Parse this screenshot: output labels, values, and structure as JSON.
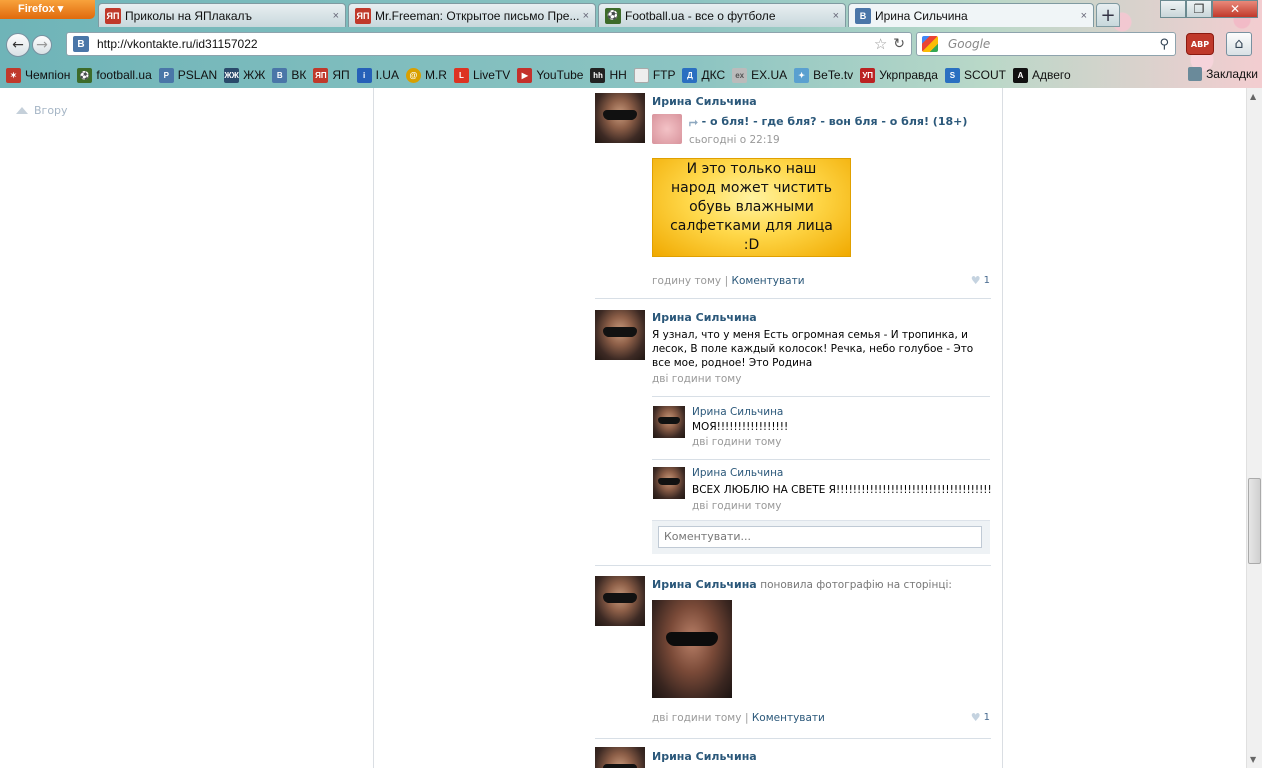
{
  "browser": {
    "app_button": "Firefox ▾",
    "tabs": [
      {
        "favicon": "ЯП",
        "title": "Приколы на ЯПлакалъ",
        "close": "×"
      },
      {
        "favicon": "ЯП",
        "title": "Mr.Freeman: Открытое письмо Пре...",
        "close": "×"
      },
      {
        "favicon": "⚽",
        "title": "Football.ua - все о футболе",
        "close": "×"
      },
      {
        "favicon": "В",
        "title": "Ирина Сильчина",
        "close": "×"
      }
    ],
    "new_tab": "+",
    "window_controls": [
      "–",
      "❐",
      "✕"
    ],
    "url": "http://vkontakte.ru/id31157022",
    "search_placeholder": "Google",
    "abp": "ABP",
    "bookmarks": [
      "Чемпіон",
      "football.ua",
      "PSLAN",
      "ЖЖ",
      "ВК",
      "ЯП",
      "I.UA",
      "M.R",
      "LiveTV",
      "YouTube",
      "НН",
      "FTP",
      "ДКС",
      "EX.UA",
      "BeTe.tv",
      "Укрправда",
      "SCOUT",
      "Адвего"
    ],
    "bookmarks_menu": "Закладки"
  },
  "page": {
    "scroll_up": "Вгору",
    "posts": [
      {
        "author": "Ирина Сильчина",
        "share_title": "- о бля! - где бля? - вон бля - о бля! (18+)",
        "share_date": "сьогодні о 22:19",
        "image_text": "И это только наш народ может чистить обувь влажными салфетками для лица :D",
        "time": "годину тому",
        "comment_link": "Коментувати",
        "likes": "1"
      },
      {
        "author": "Ирина Сильчина",
        "text": "Я узнал, что у меня Есть огромная семья - И тропинка, и лесок, В поле каждый колосок! Речка, небо голубое - Это все мое, родное! Это Родина",
        "time": "дві години тому",
        "comments": [
          {
            "author": "Ирина Сильчина",
            "text": "МОЯ!!!!!!!!!!!!!!!!!",
            "time": "дві години тому"
          },
          {
            "author": "Ирина Сильчина",
            "text": "ВСЕХ ЛЮБЛЮ НА СВЕТЕ Я!!!!!!!!!!!!!!!!!!!!!!!!!!!!!!!!!!!!!",
            "time": "дві години тому"
          }
        ],
        "comment_placeholder": "Коментувати..."
      },
      {
        "author": "Ирина Сильчина",
        "action": "поновила фотографію на сторінці:",
        "time": "дві години тому",
        "comment_link": "Коментувати",
        "likes": "1"
      },
      {
        "author": "Ирина Сильчина"
      }
    ]
  },
  "colors": {
    "vk_link": "#2b587a",
    "vk_grey": "#999999",
    "firefox_orange": "#e06a0c"
  }
}
